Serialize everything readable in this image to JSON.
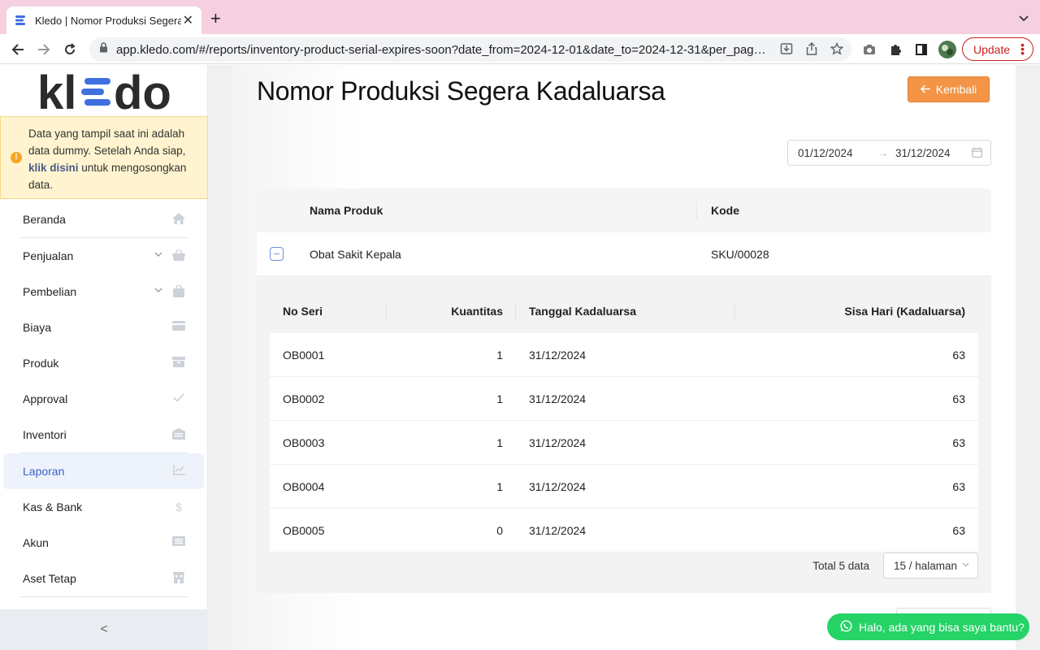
{
  "browser": {
    "tab_title": "Kledo | Nomor Produksi Segera Kadaluarsa",
    "url": "app.kledo.com/#/reports/inventory-product-serial-expires-soon?date_from=2024-12-01&date_to=2024-12-31&per_pag…",
    "update_label": "Update"
  },
  "sidebar": {
    "logo_text": "kl≡do",
    "notice_before": "Data yang tampil saat ini adalah data dummy. Setelah Anda siap, ",
    "notice_link": "klik disini",
    "notice_after": " untuk mengosongkan data.",
    "items": [
      {
        "label": "Beranda",
        "icon": "home-icon"
      },
      {
        "label": "Penjualan",
        "icon": "basket-icon"
      },
      {
        "label": "Pembelian",
        "icon": "bag-icon"
      },
      {
        "label": "Biaya",
        "icon": "card-icon"
      },
      {
        "label": "Produk",
        "icon": "box-icon"
      },
      {
        "label": "Approval",
        "icon": "check-icon"
      },
      {
        "label": "Inventori",
        "icon": "warehouse-icon"
      },
      {
        "label": "Laporan",
        "icon": "chart-icon"
      },
      {
        "label": "Kas & Bank",
        "icon": "dollar-icon"
      },
      {
        "label": "Akun",
        "icon": "list-icon"
      },
      {
        "label": "Aset Tetap",
        "icon": "building-icon"
      }
    ],
    "active_item": "Laporan",
    "collapse_label": "<"
  },
  "page": {
    "title": "Nomor Produksi Segera Kadaluarsa",
    "back_label": "Kembali",
    "date_from": "01/12/2024",
    "date_to": "31/12/2024",
    "date_separator": "→"
  },
  "table": {
    "headers": {
      "product": "Nama Produk",
      "code": "Kode"
    },
    "row": {
      "product": "Obat Sakit Kepala",
      "code": "SKU/00028"
    },
    "inner_headers": {
      "serial": "No Seri",
      "qty": "Kuantitas",
      "expiry": "Tanggal Kadaluarsa",
      "days_left": "Sisa Hari (Kadaluarsa)"
    },
    "inner_rows": [
      {
        "serial": "OB0001",
        "qty": "1",
        "expiry": "31/12/2024",
        "days_left": "63"
      },
      {
        "serial": "OB0002",
        "qty": "1",
        "expiry": "31/12/2024",
        "days_left": "63"
      },
      {
        "serial": "OB0003",
        "qty": "1",
        "expiry": "31/12/2024",
        "days_left": "63"
      },
      {
        "serial": "OB0004",
        "qty": "1",
        "expiry": "31/12/2024",
        "days_left": "63"
      },
      {
        "serial": "OB0005",
        "qty": "0",
        "expiry": "31/12/2024",
        "days_left": "63"
      }
    ],
    "total_label": "Total 5 data",
    "page_size": "15 / halaman"
  },
  "whatsapp": {
    "label": "Halo, ada yang bisa saya bantu?"
  },
  "colors": {
    "accent": "#3a62c9",
    "back_button": "#f39446",
    "whatsapp": "#25d366",
    "notice_bg": "#fff4cf"
  }
}
